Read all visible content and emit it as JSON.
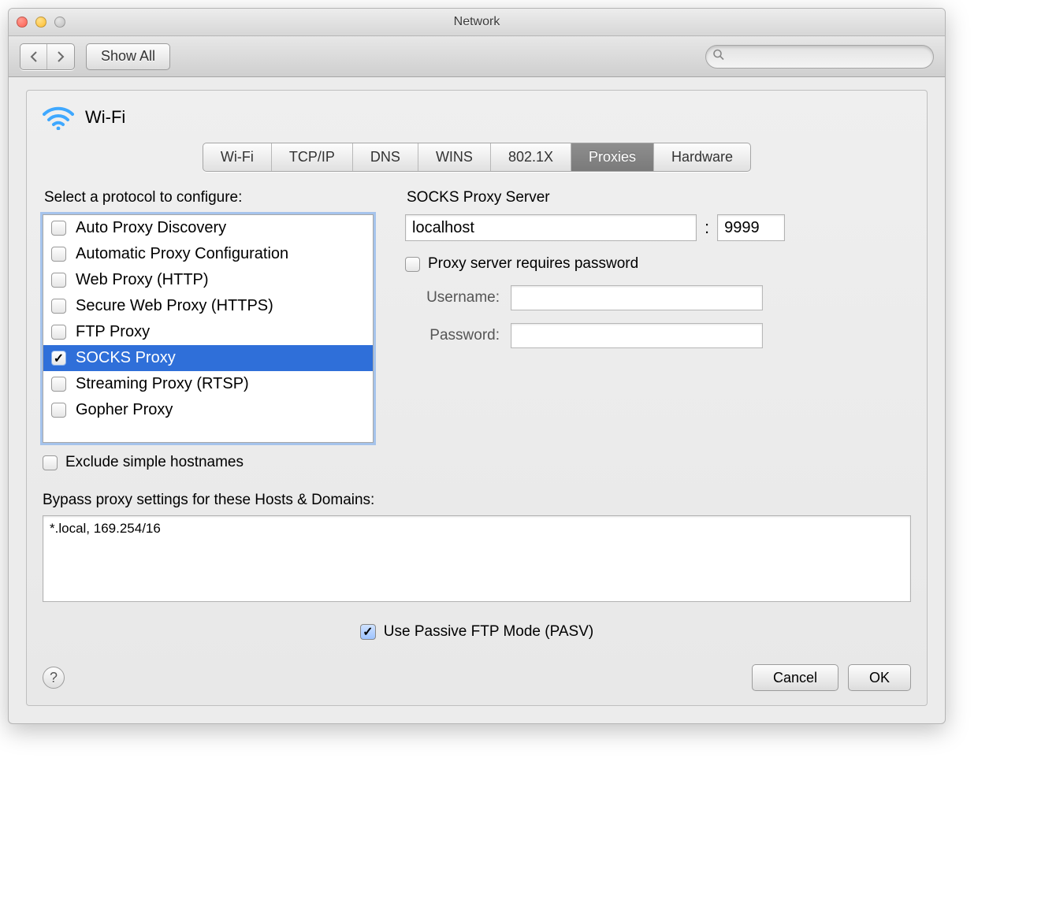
{
  "window": {
    "title": "Network"
  },
  "toolbar": {
    "show_all": "Show All",
    "search_placeholder": ""
  },
  "header": {
    "connection": "Wi-Fi"
  },
  "tabs": [
    "Wi-Fi",
    "TCP/IP",
    "DNS",
    "WINS",
    "802.1X",
    "Proxies",
    "Hardware"
  ],
  "active_tab": "Proxies",
  "left": {
    "title": "Select a protocol to configure:",
    "protocols": [
      {
        "label": "Auto Proxy Discovery",
        "checked": false,
        "selected": false
      },
      {
        "label": "Automatic Proxy Configuration",
        "checked": false,
        "selected": false
      },
      {
        "label": "Web Proxy (HTTP)",
        "checked": false,
        "selected": false
      },
      {
        "label": "Secure Web Proxy (HTTPS)",
        "checked": false,
        "selected": false
      },
      {
        "label": "FTP Proxy",
        "checked": false,
        "selected": false
      },
      {
        "label": "SOCKS Proxy",
        "checked": true,
        "selected": true
      },
      {
        "label": "Streaming Proxy (RTSP)",
        "checked": false,
        "selected": false
      },
      {
        "label": "Gopher Proxy",
        "checked": false,
        "selected": false
      }
    ],
    "exclude_label": "Exclude simple hostnames",
    "exclude_checked": false
  },
  "right": {
    "title": "SOCKS Proxy Server",
    "host": "localhost",
    "port": "9999",
    "requires_pw_label": "Proxy server requires password",
    "requires_pw_checked": false,
    "username_label": "Username:",
    "username": "",
    "password_label": "Password:",
    "password": ""
  },
  "bypass": {
    "label": "Bypass proxy settings for these Hosts & Domains:",
    "value": "*.local, 169.254/16"
  },
  "pasv": {
    "label": "Use Passive FTP Mode (PASV)",
    "checked": true
  },
  "footer": {
    "cancel": "Cancel",
    "ok": "OK"
  }
}
